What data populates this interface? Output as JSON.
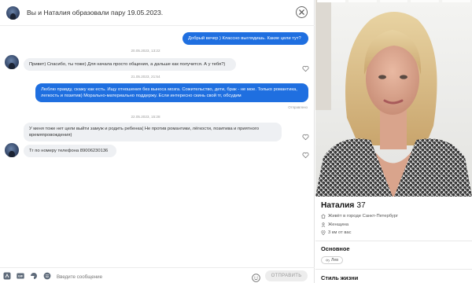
{
  "header": {
    "title": "Вы и Наталия образовали пару 19.05.2023."
  },
  "messages": [
    {
      "type": "date",
      "text": "20.05.2023, 13:22"
    },
    {
      "type": "out",
      "text": "Добрый вечер ) Классно выглядишь. Какие цели тут?"
    },
    {
      "type": "in",
      "text": "Привет) Спасибо, ты тоже) Для начала просто общения, а дальше как получится. А у тебя?)"
    },
    {
      "type": "date",
      "text": "21.05.2023, 21:54"
    },
    {
      "type": "out",
      "text": "Люблю правду, скажу как есть. Ищу отношения без выноса мозга. Сожительство, дети, брак - не мое. Только романтика, легкость и позитив) Морально-материально поддержу. Если интересно скинь свой тг, обсудим"
    },
    {
      "type": "status",
      "text": "Отправлено"
    },
    {
      "type": "date",
      "text": "22.05.2023, 15:28"
    },
    {
      "type": "in",
      "text": "У меня тоже нет цели выйти замуж и родить ребенка( Не против романтики, лёгкости, позитива и приятного времяпровождения)"
    },
    {
      "type": "in",
      "text": "Тг по номеру телефона 89006230136"
    }
  ],
  "composer": {
    "placeholder": "Введите сообщение",
    "send_label": "ОТПРАВИТЬ"
  },
  "profile": {
    "name": "Наталия",
    "age": "37",
    "city": "Живёт в городе Санкт-Петербург",
    "gender": "Женщина",
    "distance": "3 км от вас",
    "section_basic": "Основное",
    "zodiac": "Лев",
    "section_lifestyle": "Стиль жизни"
  },
  "colors": {
    "accent": "#1f6fe0",
    "incoming_bubble": "#eef0f3"
  }
}
